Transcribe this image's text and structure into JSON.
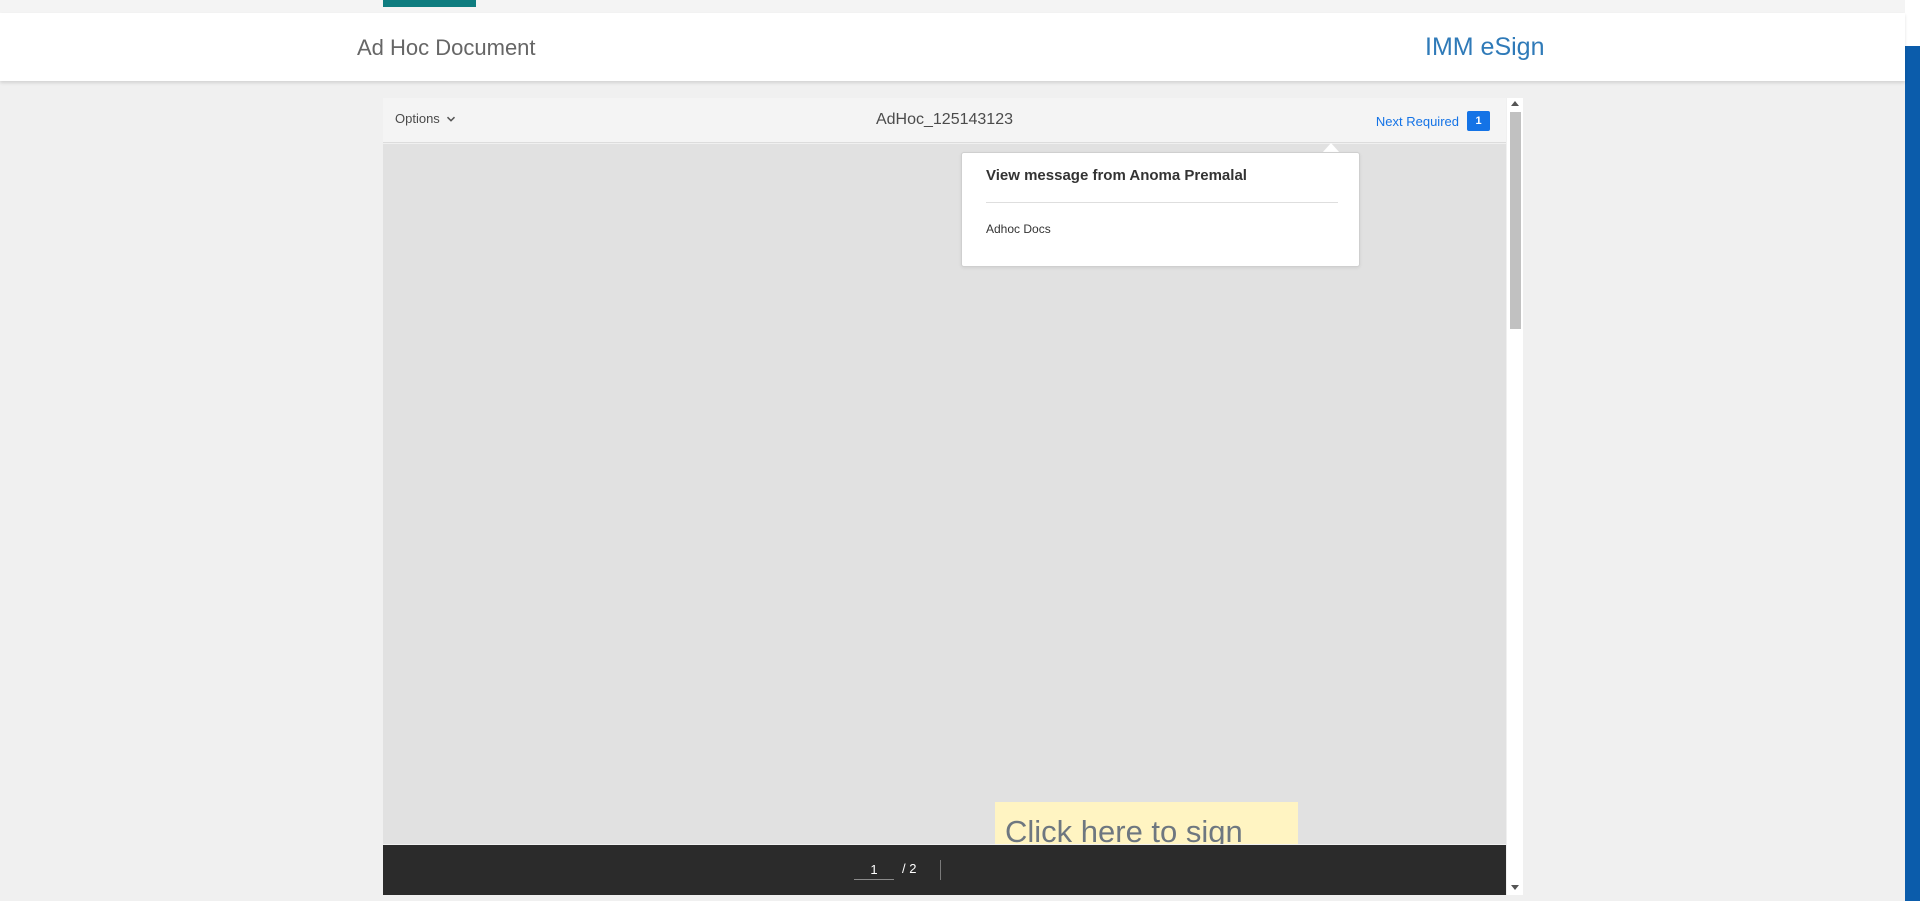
{
  "header": {
    "title": "Ad Hoc Document",
    "brand": "IMM eSign"
  },
  "viewer": {
    "options_label": "Options",
    "options_icon": "chevron-down-icon",
    "document_name": "AdHoc_125143123",
    "next_required_label": "Next Required",
    "next_required_count": "1"
  },
  "popover": {
    "title": "View message from Anoma Premalal",
    "body": "Adhoc Docs"
  },
  "sign_field": {
    "label": "Click here to sign"
  },
  "pagination": {
    "current_page": "1",
    "total": "/ 2"
  },
  "colors": {
    "accent_teal": "#0f7d80",
    "brand_blue": "#2f7ab8",
    "link_blue": "#1473e6",
    "sign_field_yellow": "#fff4c2",
    "page_bar": "#2b2b2b"
  }
}
